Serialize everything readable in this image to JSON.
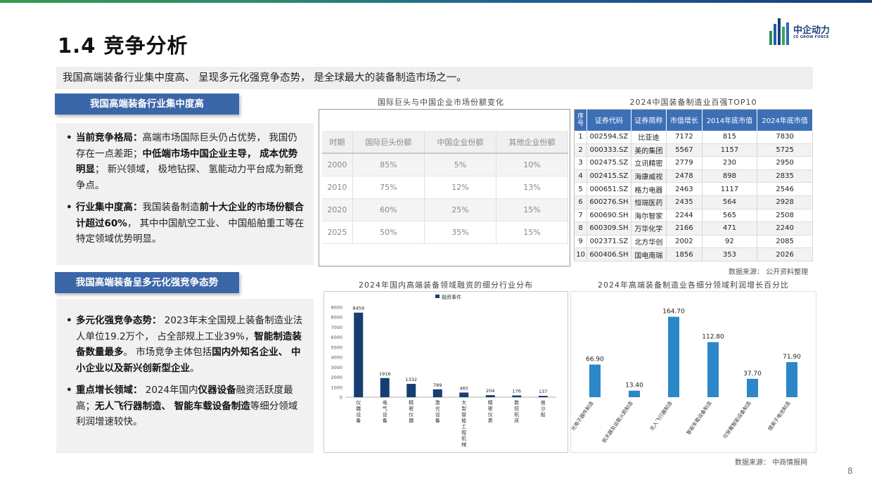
{
  "header": {
    "title": "1.4 竞争分析",
    "logo_text": "中企动力",
    "logo_sub": "CE GROW FORCE",
    "subtitle": "我国高端装备行业集中度高、 呈现多元化强竞争态势， 是全球最大的装备制造市场之一。"
  },
  "section1": {
    "title": "我国高端装备行业集中度高",
    "bullets": [
      {
        "runs": [
          {
            "t": "当前竞争格局：",
            "b": true
          },
          {
            "t": "高端市场国际巨头仍占优势， 我国仍存在一点差距；",
            "b": false
          },
          {
            "t": "中低端市场中国企业主导， 成本优势明显",
            "b": true
          },
          {
            "t": "； 新兴领域， 极地钻探、 氢能动力平台成为新竞争点。",
            "b": false
          }
        ]
      },
      {
        "runs": [
          {
            "t": "行业集中度高：",
            "b": true
          },
          {
            "t": "我国装备制造",
            "b": false
          },
          {
            "t": "前十大企业的市场份额合计超过60%",
            "b": true
          },
          {
            "t": "， 其中中国航空工业、 中国船舶重工等在特定领域优势明显。",
            "b": false
          }
        ]
      }
    ]
  },
  "section2": {
    "title": "我国高端装备呈多元化强竞争态势",
    "bullets": [
      {
        "runs": [
          {
            "t": "多元化强竞争态势：",
            "b": true
          },
          {
            "t": " 2023年末全国规上装备制造业法人单位19.2万个， 占全部规上工业39%，",
            "b": false
          },
          {
            "t": "智能制造装备数量最多",
            "b": true
          },
          {
            "t": "。 市场竞争主体包括",
            "b": false
          },
          {
            "t": "国内外知名企业、 中小企业以及新兴创新型企业",
            "b": true
          },
          {
            "t": "。",
            "b": false
          }
        ]
      },
      {
        "runs": [
          {
            "t": "重点增长领域：",
            "b": true
          },
          {
            "t": " 2024年国内",
            "b": false
          },
          {
            "t": "仪器设备",
            "b": true
          },
          {
            "t": "融资活跃度最高；",
            "b": false
          },
          {
            "t": "无人飞行器制造、 智能车载设备制造",
            "b": true
          },
          {
            "t": "等细分领域利润增速较快。",
            "b": false
          }
        ]
      }
    ]
  },
  "share_table": {
    "title": "国际巨头与中国企业市场份额变化",
    "headers": [
      "时期",
      "国际巨头份额",
      "中国企业份额",
      "其他企业份额"
    ],
    "rows": [
      [
        "2000",
        "85%",
        "5%",
        "10%"
      ],
      [
        "2010",
        "75%",
        "12%",
        "13%"
      ],
      [
        "2020",
        "60%",
        "25%",
        "15%"
      ],
      [
        "2025",
        "50%",
        "35%",
        "15%"
      ]
    ]
  },
  "top10": {
    "title": "2024中国装备制造业百强TOP10",
    "headers": [
      "序号",
      "证券代码",
      "证券简称",
      "市值增长",
      "2014年底市值",
      "2024年底市值"
    ],
    "rows": [
      [
        "1",
        "002594.SZ",
        "比亚迪",
        "7172",
        "815",
        "7830"
      ],
      [
        "2",
        "000333.SZ",
        "美的集团",
        "5567",
        "1157",
        "5725"
      ],
      [
        "3",
        "002475.SZ",
        "立讯精密",
        "2779",
        "230",
        "2950"
      ],
      [
        "4",
        "002415.SZ",
        "海康威视",
        "2478",
        "898",
        "2835"
      ],
      [
        "5",
        "000651.SZ",
        "格力电器",
        "2463",
        "1117",
        "2546"
      ],
      [
        "6",
        "600276.SH",
        "恒瑞医药",
        "2435",
        "564",
        "2928"
      ],
      [
        "7",
        "600690.SH",
        "海尔智家",
        "2244",
        "565",
        "2508"
      ],
      [
        "8",
        "600309.SH",
        "万华化学",
        "2166",
        "471",
        "2240"
      ],
      [
        "9",
        "002371.SZ",
        "北方华创",
        "2002",
        "92",
        "2085"
      ],
      [
        "10",
        "600406.SH",
        "国电南瑞",
        "1856",
        "353",
        "2026"
      ]
    ],
    "source": "数据来源： 公开资料整理"
  },
  "chart_data": [
    {
      "type": "bar",
      "title": "2024年国内高端装备领域融资的细分行业分布",
      "legend": "融资事件",
      "legend_position": "top",
      "categories": [
        "仪器设备",
        "电气设备",
        "精密仪器",
        "激光设备",
        "大型智能工程机械",
        "精密仪表",
        "数控机床",
        "凿沙船"
      ],
      "values": [
        8459,
        1916,
        1332,
        789,
        465,
        204,
        176,
        137
      ],
      "yticks": [
        "9000",
        "8000",
        "7000",
        "6000",
        "5000",
        "4000",
        "3000",
        "2000",
        "1000",
        "0"
      ],
      "ylim": [
        0,
        9000
      ],
      "color": "#173e73",
      "grid": false
    },
    {
      "type": "bar",
      "title": "2024年高端装备制造业各细分领域利润增长百分比",
      "categories": [
        "光电子器件制造",
        "航天器及运载火箭制造",
        "无人飞行器制造",
        "智能车载设备制造",
        "可穿戴智能设备制造",
        "锂离子电池制造"
      ],
      "values": [
        66.9,
        13.4,
        164.7,
        112.8,
        37.7,
        71.9
      ],
      "value_labels": [
        "66.90",
        "13.40",
        "164.70",
        "112.80",
        "37.70",
        "71.90"
      ],
      "ylim": [
        0,
        180
      ],
      "color": "#2b87c8",
      "grid": false
    }
  ],
  "bottom_source": "数据来源： 中商情报网",
  "page_number": "8",
  "colors": {
    "accent_blue": "#3b66a8",
    "table_header": "#3c6fb6",
    "bar_dark": "#173e73",
    "bar_light": "#2b87c8"
  }
}
